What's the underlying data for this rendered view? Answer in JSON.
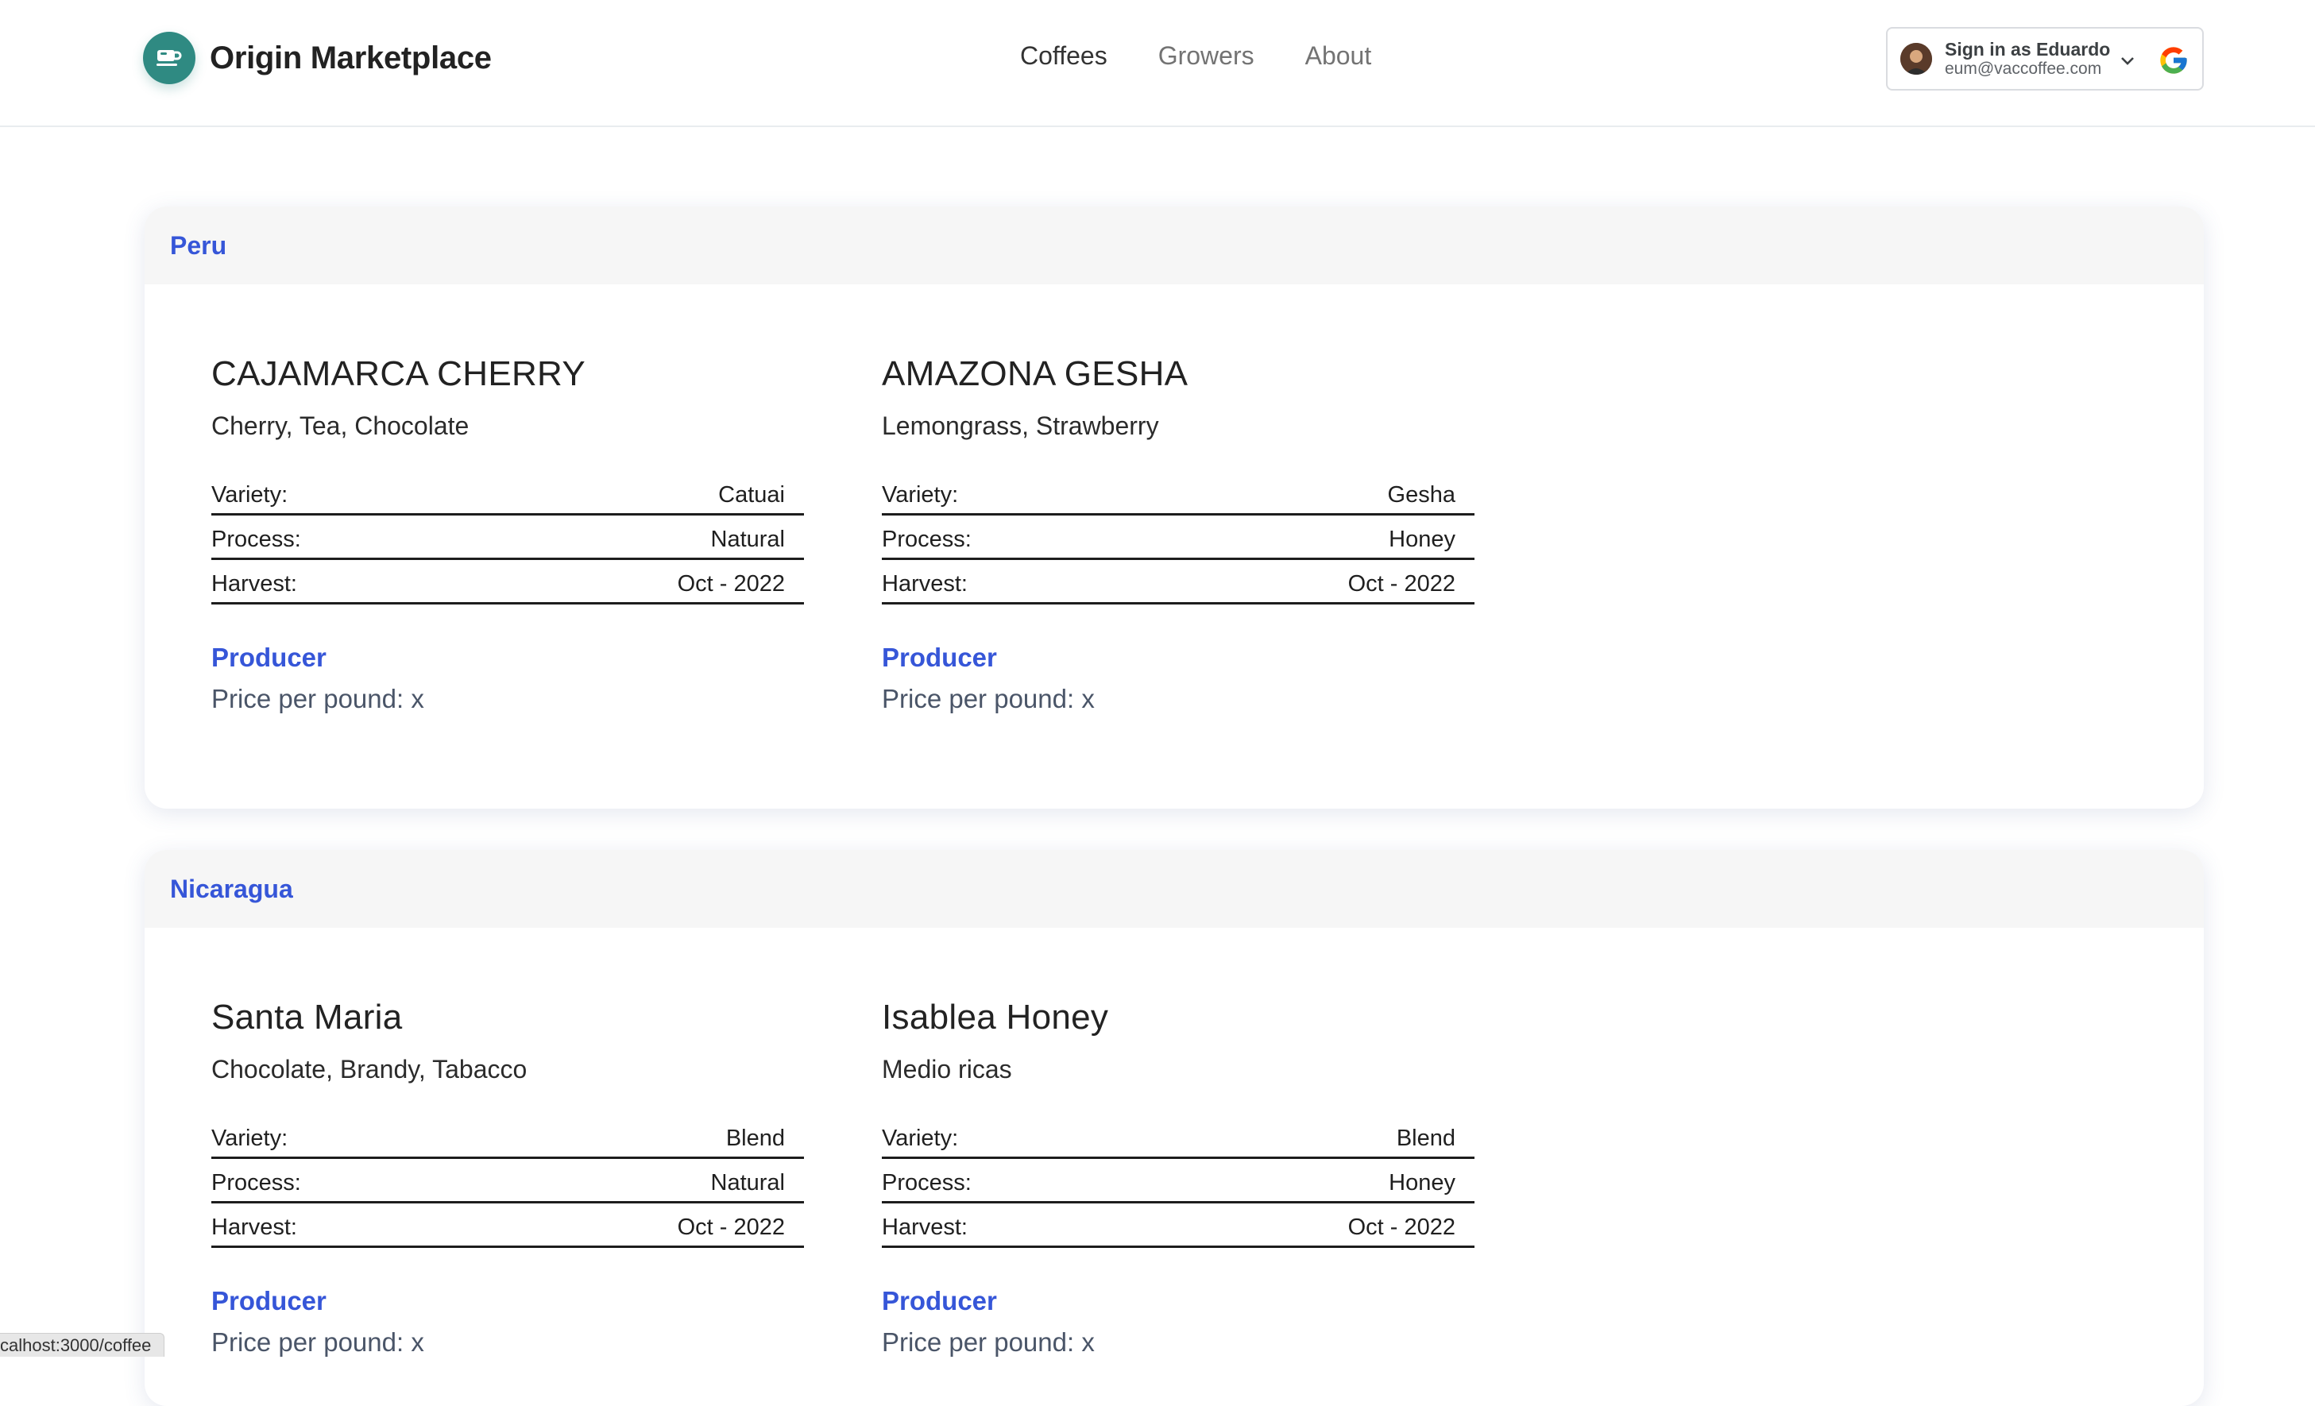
{
  "brand": {
    "name": "Origin Marketplace",
    "logo_icon": "coffee-cup-icon",
    "accent": "#2f8a82"
  },
  "nav": [
    {
      "label": "Coffees",
      "active": true
    },
    {
      "label": "Growers",
      "active": false
    },
    {
      "label": "About",
      "active": false
    }
  ],
  "signin": {
    "title": "Sign in as Eduardo",
    "email": "eum@vaccoffee.com"
  },
  "regions": [
    {
      "name": "Peru",
      "coffees": [
        {
          "name": "CAJAMARCA CHERRY",
          "notes": "Cherry, Tea, Chocolate",
          "specs": [
            {
              "label": "Variety:",
              "value": "Catuai"
            },
            {
              "label": "Process:",
              "value": "Natural"
            },
            {
              "label": "Harvest:",
              "value": "Oct - 2022"
            }
          ],
          "producer_label": "Producer",
          "price_label": "Price per pound: x"
        },
        {
          "name": "AMAZONA GESHA",
          "notes": "Lemongrass, Strawberry",
          "specs": [
            {
              "label": "Variety:",
              "value": "Gesha"
            },
            {
              "label": "Process:",
              "value": "Honey"
            },
            {
              "label": "Harvest:",
              "value": "Oct - 2022"
            }
          ],
          "producer_label": "Producer",
          "price_label": "Price per pound: x"
        }
      ]
    },
    {
      "name": "Nicaragua",
      "coffees": [
        {
          "name": "Santa Maria",
          "notes": "Chocolate, Brandy, Tabacco",
          "specs": [
            {
              "label": "Variety:",
              "value": "Blend"
            },
            {
              "label": "Process:",
              "value": "Natural"
            },
            {
              "label": "Harvest:",
              "value": "Oct - 2022"
            }
          ],
          "producer_label": "Producer",
          "price_label": "Price per pound: x"
        },
        {
          "name": "Isablea Honey",
          "notes": "Medio ricas",
          "specs": [
            {
              "label": "Variety:",
              "value": "Blend"
            },
            {
              "label": "Process:",
              "value": "Honey"
            },
            {
              "label": "Harvest:",
              "value": "Oct - 2022"
            }
          ],
          "producer_label": "Producer",
          "price_label": "Price per pound: x"
        }
      ]
    }
  ],
  "status_url": "calhost:3000/coffee",
  "colors": {
    "link": "#3656d8",
    "header_bg": "#f6f6f6"
  }
}
